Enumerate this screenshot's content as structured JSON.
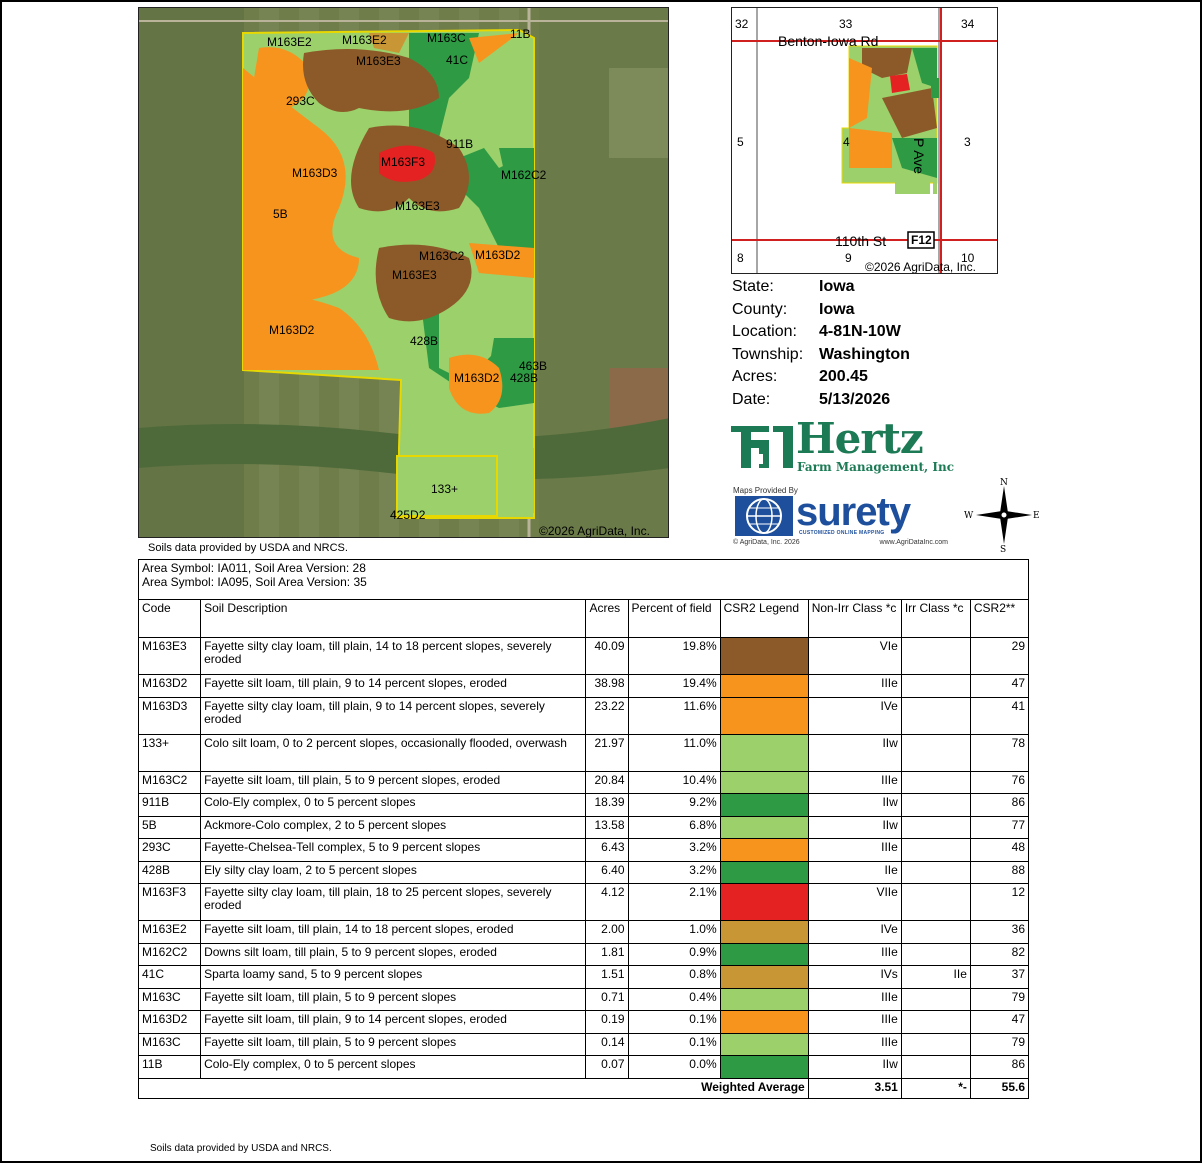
{
  "map": {
    "copyright": "©2026 AgriData, Inc.",
    "labels": [
      {
        "text": "M163E2",
        "key": "a"
      },
      {
        "text": "M163E2",
        "key": "b"
      },
      {
        "text": "M163C",
        "key": "c"
      },
      {
        "text": "11B",
        "key": "d"
      },
      {
        "text": "M163E3",
        "key": "e"
      },
      {
        "text": "41C",
        "key": "f"
      },
      {
        "text": "293C",
        "key": "g"
      },
      {
        "text": "911B",
        "key": "h"
      },
      {
        "text": "M163F3",
        "key": "i"
      },
      {
        "text": "M163D3",
        "key": "j"
      },
      {
        "text": "M162C2",
        "key": "k"
      },
      {
        "text": "5B",
        "key": "l"
      },
      {
        "text": "M163E3",
        "key": "m"
      },
      {
        "text": "M163C2",
        "key": "n"
      },
      {
        "text": "M163D2",
        "key": "o"
      },
      {
        "text": "M163E3",
        "key": "p"
      },
      {
        "text": "M163D2",
        "key": "q"
      },
      {
        "text": "428B",
        "key": "r"
      },
      {
        "text": "463B",
        "key": "s"
      },
      {
        "text": "M163D2",
        "key": "t"
      },
      {
        "text": "428B",
        "key": "u"
      },
      {
        "text": "133+",
        "key": "v"
      },
      {
        "text": "425D2",
        "key": "w"
      }
    ]
  },
  "locator": {
    "sections": [
      "32",
      "33",
      "34",
      "5",
      "4",
      "3",
      "8",
      "9",
      "10"
    ],
    "road_top": "Benton-Iowa Rd",
    "road_bottom": "110th St",
    "road_side": "P Ave",
    "route": "F12",
    "copyright": "©2026 AgriData, Inc."
  },
  "info": [
    {
      "label": "State:",
      "value": "Iowa"
    },
    {
      "label": "County:",
      "value": "Iowa"
    },
    {
      "label": "Location:",
      "value": "4-81N-10W"
    },
    {
      "label": "Township:",
      "value": "Washington"
    },
    {
      "label": "Acres:",
      "value": "200.45"
    },
    {
      "label": "Date:",
      "value": "5/13/2026"
    }
  ],
  "logos": {
    "hertz_word": "Hertz",
    "hertz_sub": "Farm Management, Inc",
    "maps_provided_by": "Maps Provided By",
    "surety_word": "surety",
    "surety_tag": "CUSTOMIZED ONLINE MAPPING",
    "surety_copy": "© AgriData, Inc. 2026",
    "surety_url": "www.AgriDataInc.com"
  },
  "compass": {
    "n": "N",
    "s": "S",
    "e": "E",
    "w": "W"
  },
  "notes": {
    "top": "Soils data provided by USDA and NRCS.",
    "bottom": "Soils data provided by USDA and NRCS."
  },
  "table": {
    "area_line_1": "Area Symbol: IA011, Soil Area Version: 28",
    "area_line_2": "Area Symbol: IA095, Soil Area Version: 35",
    "headers": {
      "code": "Code",
      "desc": "Soil Description",
      "acres": "Acres",
      "pct": "Percent of field",
      "legend": "CSR2 Legend",
      "nonirr": "Non-Irr Class *c",
      "irr": "Irr Class *c",
      "csr2": "CSR2**"
    },
    "rows": [
      {
        "code": "M163E3",
        "desc": "Fayette silty clay loam, till plain, 14 to 18 percent slopes, severely eroded",
        "acres": "40.09",
        "pct": "19.8%",
        "color": "#8c5a28",
        "nonirr": "VIe",
        "irr": "",
        "csr2": "29",
        "tall": true
      },
      {
        "code": "M163D2",
        "desc": "Fayette silt loam, till plain, 9 to 14 percent slopes, eroded",
        "acres": "38.98",
        "pct": "19.4%",
        "color": "#f7941d",
        "nonirr": "IIIe",
        "irr": "",
        "csr2": "47",
        "tall": false
      },
      {
        "code": "M163D3",
        "desc": "Fayette silty clay loam, till plain, 9 to 14 percent slopes, severely eroded",
        "acres": "23.22",
        "pct": "11.6%",
        "color": "#f7941d",
        "nonirr": "IVe",
        "irr": "",
        "csr2": "41",
        "tall": true
      },
      {
        "code": "133+",
        "desc": "Colo silt loam, 0 to 2 percent slopes, occasionally flooded, overwash",
        "acres": "21.97",
        "pct": "11.0%",
        "color": "#9bd06b",
        "nonirr": "IIw",
        "irr": "",
        "csr2": "78",
        "tall": true
      },
      {
        "code": "M163C2",
        "desc": "Fayette silt loam, till plain, 5 to 9 percent slopes, eroded",
        "acres": "20.84",
        "pct": "10.4%",
        "color": "#9bd06b",
        "nonirr": "IIIe",
        "irr": "",
        "csr2": "76",
        "tall": false
      },
      {
        "code": "911B",
        "desc": "Colo-Ely complex, 0 to 5 percent slopes",
        "acres": "18.39",
        "pct": "9.2%",
        "color": "#2e9a44",
        "nonirr": "IIw",
        "irr": "",
        "csr2": "86",
        "tall": false
      },
      {
        "code": "5B",
        "desc": "Ackmore-Colo complex, 2 to 5 percent slopes",
        "acres": "13.58",
        "pct": "6.8%",
        "color": "#9bd06b",
        "nonirr": "IIw",
        "irr": "",
        "csr2": "77",
        "tall": false
      },
      {
        "code": "293C",
        "desc": "Fayette-Chelsea-Tell complex, 5 to 9 percent slopes",
        "acres": "6.43",
        "pct": "3.2%",
        "color": "#f7941d",
        "nonirr": "IIIe",
        "irr": "",
        "csr2": "48",
        "tall": false
      },
      {
        "code": "428B",
        "desc": "Ely silty clay loam, 2 to 5 percent slopes",
        "acres": "6.40",
        "pct": "3.2%",
        "color": "#2e9a44",
        "nonirr": "IIe",
        "irr": "",
        "csr2": "88",
        "tall": false
      },
      {
        "code": "M163F3",
        "desc": "Fayette silty clay loam, till plain, 18 to 25 percent slopes, severely eroded",
        "acres": "4.12",
        "pct": "2.1%",
        "color": "#e42222",
        "nonirr": "VIIe",
        "irr": "",
        "csr2": "12",
        "tall": true
      },
      {
        "code": "M163E2",
        "desc": "Fayette silt loam, till plain, 14 to 18 percent slopes, eroded",
        "acres": "2.00",
        "pct": "1.0%",
        "color": "#c99636",
        "nonirr": "IVe",
        "irr": "",
        "csr2": "36",
        "tall": false
      },
      {
        "code": "M162C2",
        "desc": "Downs silt loam, till plain, 5 to 9 percent slopes, eroded",
        "acres": "1.81",
        "pct": "0.9%",
        "color": "#2e9a44",
        "nonirr": "IIIe",
        "irr": "",
        "csr2": "82",
        "tall": false
      },
      {
        "code": "41C",
        "desc": "Sparta loamy sand, 5 to 9 percent slopes",
        "acres": "1.51",
        "pct": "0.8%",
        "color": "#c99636",
        "nonirr": "IVs",
        "irr": "IIe",
        "csr2": "37",
        "tall": false
      },
      {
        "code": "M163C",
        "desc": "Fayette silt loam, till plain, 5 to 9 percent slopes",
        "acres": "0.71",
        "pct": "0.4%",
        "color": "#9bd06b",
        "nonirr": "IIIe",
        "irr": "",
        "csr2": "79",
        "tall": false
      },
      {
        "code": "M163D2",
        "desc": "Fayette silt loam, till plain, 9 to 14 percent slopes, eroded",
        "acres": "0.19",
        "pct": "0.1%",
        "color": "#f7941d",
        "nonirr": "IIIe",
        "irr": "",
        "csr2": "47",
        "tall": false
      },
      {
        "code": "M163C",
        "desc": "Fayette silt loam, till plain, 5 to 9 percent slopes",
        "acres": "0.14",
        "pct": "0.1%",
        "color": "#9bd06b",
        "nonirr": "IIIe",
        "irr": "",
        "csr2": "79",
        "tall": false
      },
      {
        "code": "11B",
        "desc": "Colo-Ely complex, 0 to 5 percent slopes",
        "acres": "0.07",
        "pct": "0.0%",
        "color": "#2e9a44",
        "nonirr": "IIw",
        "irr": "",
        "csr2": "86",
        "tall": false
      }
    ],
    "weighted": {
      "label": "Weighted Average",
      "nonirr": "3.51",
      "irr": "*-",
      "csr2": "55.6"
    }
  }
}
